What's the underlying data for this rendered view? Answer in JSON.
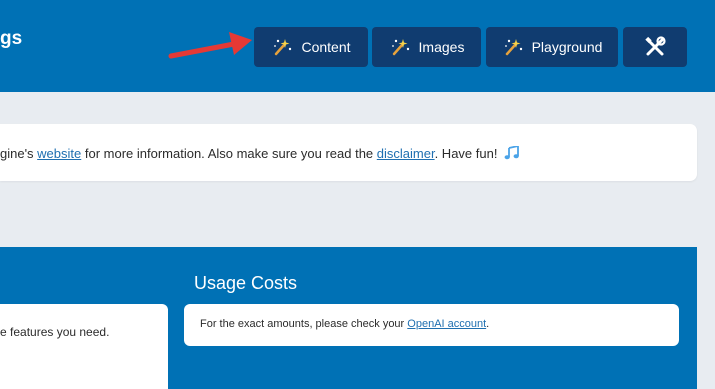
{
  "header": {
    "title_fragment": "gs",
    "nav": [
      {
        "label": "Content",
        "icon": "magic-wand-icon"
      },
      {
        "label": "Images",
        "icon": "magic-wand-icon"
      },
      {
        "label": "Playground",
        "icon": "magic-wand-icon"
      }
    ],
    "tools_icon": "tools-icon"
  },
  "notice": {
    "prefix": "gine's ",
    "link1": "website",
    "middle": " for more information. Also make sure you read the ",
    "link2": "disclaimer",
    "suffix": ". Have fun!",
    "icon": "music-note-icon"
  },
  "features_card": {
    "text": "e features you need."
  },
  "usage": {
    "title": "Usage Costs",
    "text_prefix": "For the exact amounts, please check your ",
    "link": "OpenAI account",
    "text_suffix": "."
  },
  "colors": {
    "header_bg": "#0071b5",
    "button_bg": "#103c70",
    "page_bg": "#e8ecf1",
    "arrow": "#e53935",
    "link": "#1f6fb0"
  }
}
